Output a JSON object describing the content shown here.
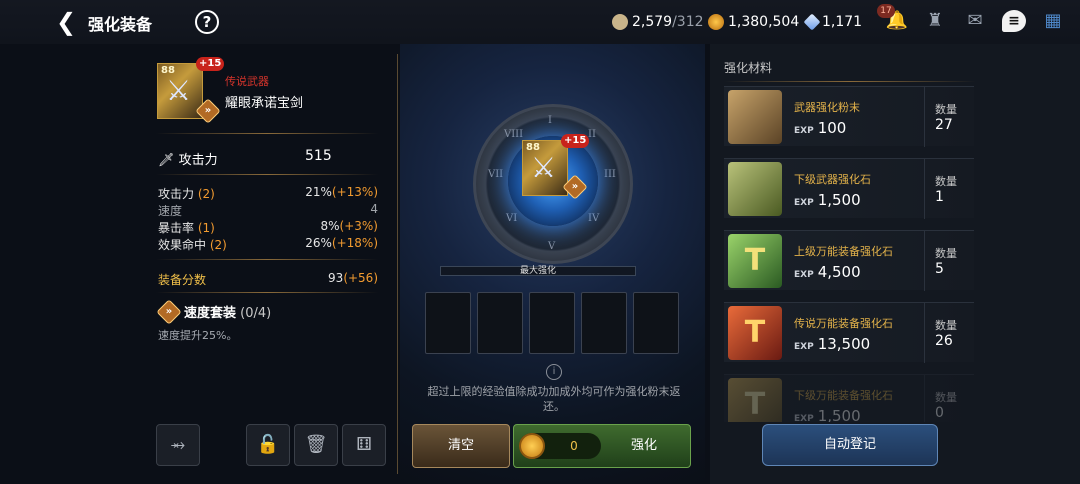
{
  "header": {
    "back_icon": "back-arrow-icon",
    "title": "强化装备",
    "help_icon": "question-mark-icon",
    "currencies": [
      {
        "icon": "scroll-plus-icon",
        "value": "2,579",
        "max": "/312"
      },
      {
        "icon": "gold-coin-icon",
        "value": "1,380,504",
        "max": ""
      },
      {
        "icon": "crystal-icon",
        "value": "1,171",
        "max": ""
      }
    ],
    "bell_badge": "17",
    "icons": [
      "bell-icon",
      "guild-icon",
      "mail-icon",
      "chat-icon",
      "menu-grid-icon"
    ]
  },
  "item": {
    "level": "88",
    "plus": "+15",
    "grade": "传说武器",
    "name": "耀眼承诺宝剑",
    "set_rune": "»"
  },
  "stats": {
    "main_label": "攻击力",
    "main_value": "515",
    "sub": [
      {
        "label": "攻击力",
        "count": "(2)",
        "value": "21%",
        "bonus": "(+13%)"
      },
      {
        "label": "速度",
        "count": "",
        "value": "4",
        "bonus": ""
      },
      {
        "label": "暴击率",
        "count": "(1)",
        "value": "8%",
        "bonus": "(+3%)"
      },
      {
        "label": "效果命中",
        "count": "(2)",
        "value": "26%",
        "bonus": "(+18%)"
      }
    ],
    "score_label": "装备分数",
    "score_value": "93",
    "score_bonus": "(+56)",
    "set_name": "速度套装",
    "set_count": "(0/4)",
    "set_desc": "速度提升25%。"
  },
  "center": {
    "roman": [
      "I",
      "II",
      "III",
      "IV",
      "V",
      "VI",
      "VII",
      "VIII"
    ],
    "max_label": "最大强化",
    "max_progress": 0,
    "note": "超过上限的经验值除成功加成外均可作为强化粉末返还。",
    "clear_label": "清空",
    "gold_cost": "0",
    "enhance_label": "强化"
  },
  "materials": {
    "title": "强化材料",
    "qty_label": "数量",
    "exp_tag": "EXP",
    "items": [
      {
        "name": "武器强化粉末",
        "exp": "100",
        "qty": "27",
        "icon": "powder-icon",
        "color": "#7a5a32"
      },
      {
        "name": "下级武器强化石",
        "exp": "1,500",
        "qty": "1",
        "icon": "stone-icon",
        "color": "#4f6a2a"
      },
      {
        "name": "上级万能装备强化石",
        "exp": "4,500",
        "qty": "5",
        "icon": "rune-t-green-icon",
        "color": "#2f5a2a"
      },
      {
        "name": "传说万能装备强化石",
        "exp": "13,500",
        "qty": "26",
        "icon": "rune-t-red-icon",
        "color": "#6a2a1a"
      },
      {
        "name": "下级万能装备强化石",
        "exp": "1,500",
        "qty": "0",
        "icon": "rune-t-gold-icon",
        "color": "#5a4a22"
      }
    ],
    "auto_label": "自动登记"
  },
  "bottom_icons": [
    "share-icon",
    "lock-icon",
    "trash-icon",
    "dice-icon"
  ]
}
